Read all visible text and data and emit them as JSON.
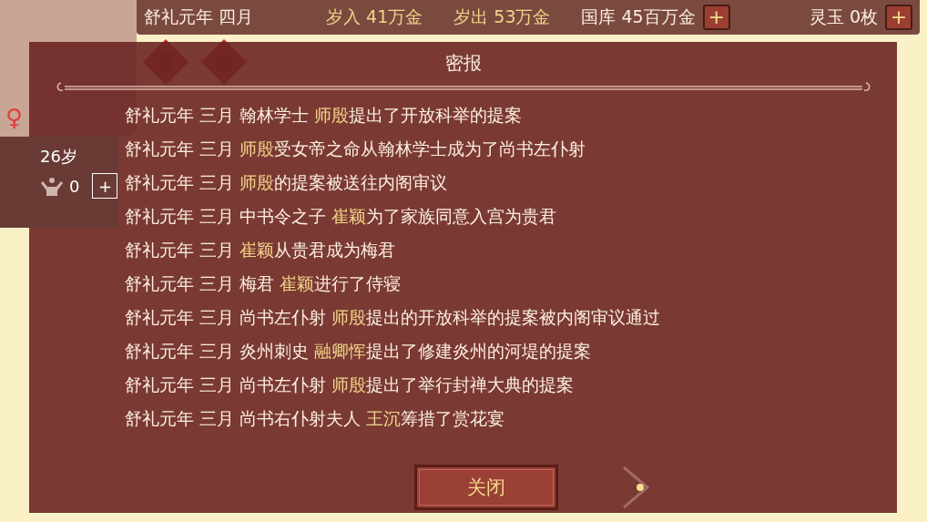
{
  "top_bar": {
    "items": [
      {
        "text": "舒礼元年 四月",
        "accent": false,
        "has_add": false
      },
      {
        "text": "岁入 41万金",
        "accent": true,
        "has_add": false
      },
      {
        "text": "岁出 53万金",
        "accent": true,
        "has_add": false
      },
      {
        "text": "国库 45百万金",
        "accent": false,
        "has_add": true,
        "add_label": "+"
      },
      {
        "text": "灵玉 0枚",
        "accent": false,
        "has_add": true,
        "add_label": "+"
      }
    ]
  },
  "character": {
    "gender_symbol": "♀",
    "age": "26岁",
    "strength": "0",
    "add_label": "+"
  },
  "dialog": {
    "title": "密报",
    "entries": [
      {
        "date": "舒礼元年 三月",
        "parts": [
          {
            "kind": "plain",
            "text": "翰林学士 "
          },
          {
            "kind": "name",
            "text": "师殷"
          },
          {
            "kind": "plain",
            "text": "提出了开放科举的提案"
          }
        ]
      },
      {
        "date": "舒礼元年 三月",
        "parts": [
          {
            "kind": "name",
            "text": "师殷"
          },
          {
            "kind": "plain",
            "text": "受女帝之命从翰林学士成为了尚书左仆射"
          }
        ]
      },
      {
        "date": "舒礼元年 三月",
        "parts": [
          {
            "kind": "name",
            "text": "师殷"
          },
          {
            "kind": "plain",
            "text": "的提案被送往内阁审议"
          }
        ]
      },
      {
        "date": "舒礼元年 三月",
        "parts": [
          {
            "kind": "plain",
            "text": "中书令之子 "
          },
          {
            "kind": "name",
            "text": "崔颖"
          },
          {
            "kind": "plain",
            "text": "为了家族同意入宫为贵君"
          }
        ]
      },
      {
        "date": "舒礼元年 三月",
        "parts": [
          {
            "kind": "name",
            "text": "崔颖"
          },
          {
            "kind": "plain",
            "text": "从贵君成为梅君"
          }
        ]
      },
      {
        "date": "舒礼元年 三月",
        "parts": [
          {
            "kind": "plain",
            "text": "梅君 "
          },
          {
            "kind": "name",
            "text": "崔颖"
          },
          {
            "kind": "plain",
            "text": "进行了侍寝"
          }
        ]
      },
      {
        "date": "舒礼元年 三月",
        "parts": [
          {
            "kind": "plain",
            "text": "尚书左仆射 "
          },
          {
            "kind": "name",
            "text": "师殷"
          },
          {
            "kind": "plain",
            "text": "提出的开放科举的提案被内阁审议通过"
          }
        ]
      },
      {
        "date": "舒礼元年 三月",
        "parts": [
          {
            "kind": "plain",
            "text": "炎州刺史 "
          },
          {
            "kind": "name",
            "text": "融卿恽"
          },
          {
            "kind": "plain",
            "text": "提出了修建炎州的河堤的提案"
          }
        ]
      },
      {
        "date": "舒礼元年 三月",
        "parts": [
          {
            "kind": "plain",
            "text": "尚书左仆射 "
          },
          {
            "kind": "name",
            "text": "师殷"
          },
          {
            "kind": "plain",
            "text": "提出了举行封禅大典的提案"
          }
        ]
      },
      {
        "date": "舒礼元年 三月",
        "parts": [
          {
            "kind": "plain",
            "text": "尚书右仆射夫人 "
          },
          {
            "kind": "name",
            "text": "王沉"
          },
          {
            "kind": "plain",
            "text": "筹措了赏花宴"
          }
        ]
      }
    ],
    "close_label": "关闭"
  }
}
